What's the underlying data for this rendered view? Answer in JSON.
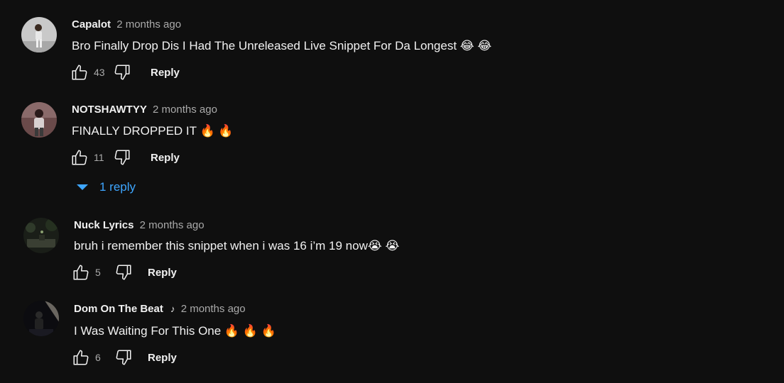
{
  "comments": [
    {
      "author": "Capalot",
      "time": "2 months ago",
      "text": "Bro Finally Drop Dis I Had The Unreleased Live Snippet For Da Longest 😂 😂",
      "likes": "43",
      "reply_label": "Reply",
      "avatar_icon": "user-avatar"
    },
    {
      "author": "NOTSHAWTYY",
      "time": "2 months ago",
      "text": "FINALLY DROPPED IT 🔥 🔥",
      "likes": "11",
      "reply_label": "Reply",
      "replies_label": "1 reply",
      "avatar_icon": "user-avatar"
    },
    {
      "author": "Nuck Lyrics",
      "time": "2 months ago",
      "text": "bruh i remember this snippet when i was 16 i’m 19 now😭 😭",
      "likes": "5",
      "reply_label": "Reply",
      "avatar_icon": "user-avatar"
    },
    {
      "author": "Dom On The Beat",
      "time": "2 months ago",
      "text": "I Was Waiting For This One 🔥 🔥 🔥",
      "likes": "6",
      "reply_label": "Reply",
      "badge_icon": "music-note-icon",
      "avatar_icon": "user-avatar"
    }
  ],
  "colors": {
    "background": "#0f0f0f",
    "text": "#f1f1f1",
    "secondary": "#aaaaaa",
    "link": "#3ea6ff"
  }
}
